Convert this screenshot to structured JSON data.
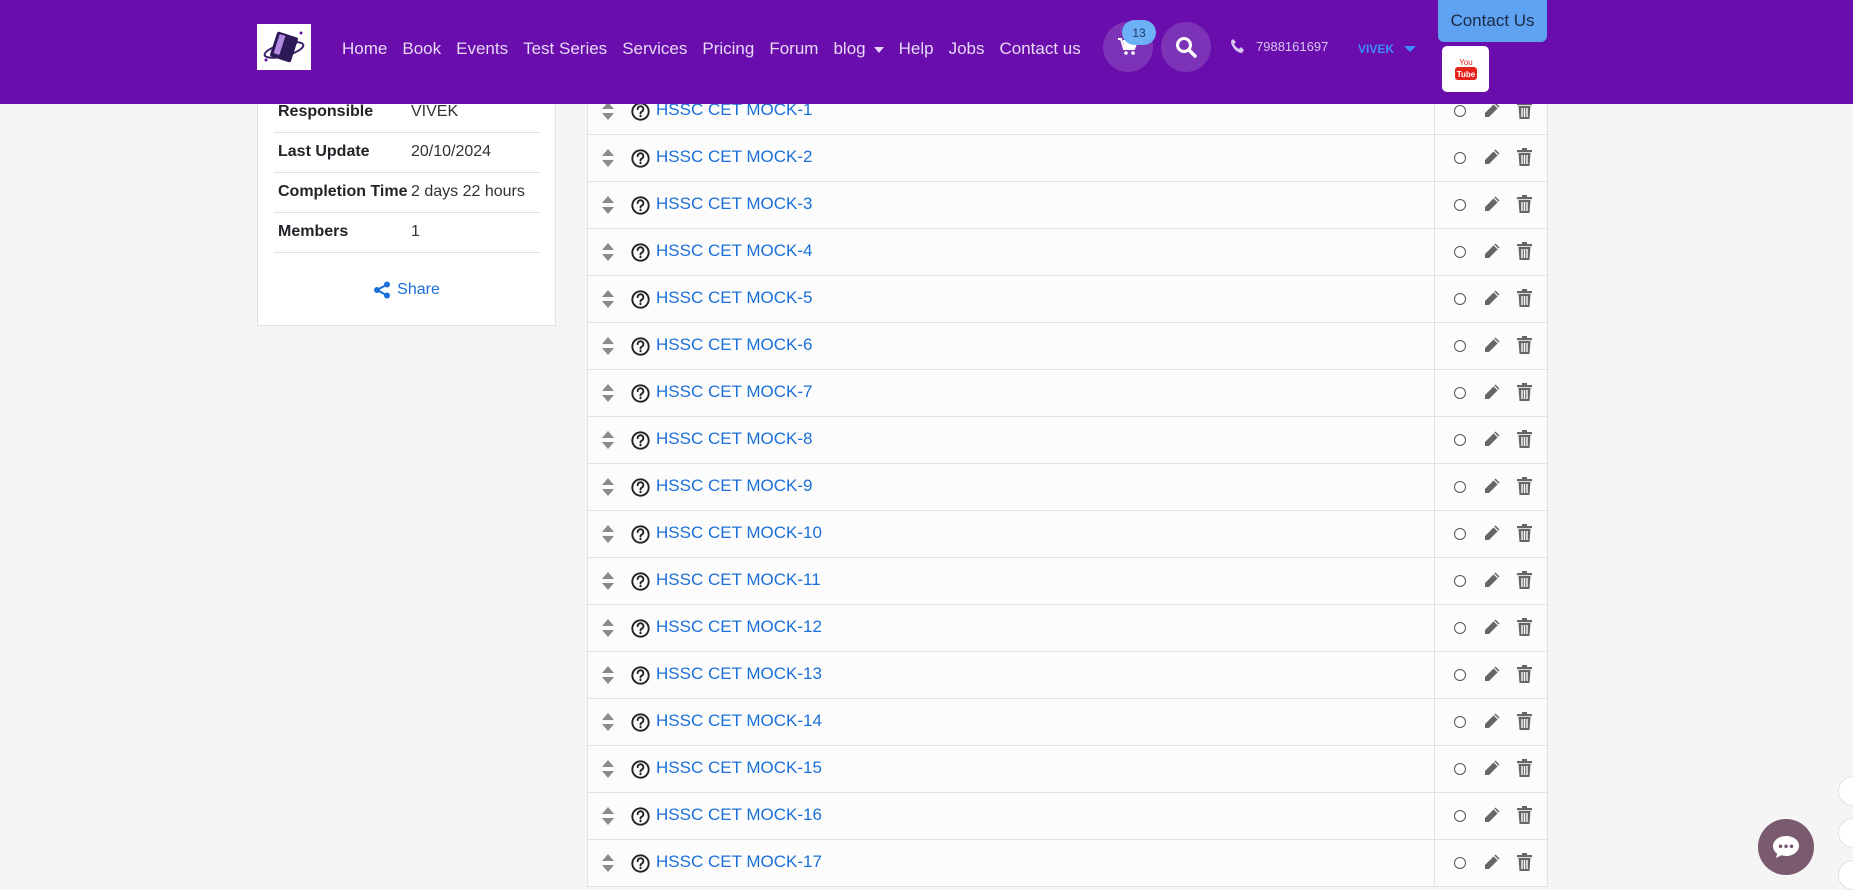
{
  "nav": {
    "links": [
      {
        "label": "Home"
      },
      {
        "label": "Book"
      },
      {
        "label": "Events"
      },
      {
        "label": "Test Series"
      },
      {
        "label": "Services"
      },
      {
        "label": "Pricing"
      },
      {
        "label": "Forum"
      },
      {
        "label": "blog",
        "dropdown": true
      },
      {
        "label": "Help"
      },
      {
        "label": "Jobs"
      },
      {
        "label": "Contact us"
      }
    ],
    "cart_count": "13",
    "phone": "7988161697",
    "user_name": "VIVEK",
    "contact_button": "Contact Us",
    "icons": {
      "cart": "cart-icon",
      "search": "search-icon",
      "phone": "phone-icon",
      "youtube": "youtube-icon",
      "chat": "chat-icon"
    }
  },
  "info": {
    "rows": [
      {
        "key": "Responsible",
        "value": "VIVEK"
      },
      {
        "key": "Last Update",
        "value": "20/10/2024"
      },
      {
        "key": "Completion Time",
        "value": "2 days 22 hours"
      },
      {
        "key": "Members",
        "value": "1"
      }
    ],
    "share_label": "Share"
  },
  "lessons": [
    {
      "title": "HSSC CET MOCK-1"
    },
    {
      "title": "HSSC CET MOCK-2"
    },
    {
      "title": "HSSC CET MOCK-3"
    },
    {
      "title": "HSSC CET MOCK-4"
    },
    {
      "title": "HSSC CET MOCK-5"
    },
    {
      "title": "HSSC CET MOCK-6"
    },
    {
      "title": "HSSC CET MOCK-7"
    },
    {
      "title": "HSSC CET MOCK-8"
    },
    {
      "title": "HSSC CET MOCK-9"
    },
    {
      "title": "HSSC CET MOCK-10"
    },
    {
      "title": "HSSC CET MOCK-11"
    },
    {
      "title": "HSSC CET MOCK-12"
    },
    {
      "title": "HSSC CET MOCK-13"
    },
    {
      "title": "HSSC CET MOCK-14"
    },
    {
      "title": "HSSC CET MOCK-15"
    },
    {
      "title": "HSSC CET MOCK-16"
    },
    {
      "title": "HSSC CET MOCK-17"
    }
  ],
  "colors": {
    "navbar": "#6a0dad",
    "link": "#1a6fd8",
    "accent": "#5fa2f2"
  }
}
